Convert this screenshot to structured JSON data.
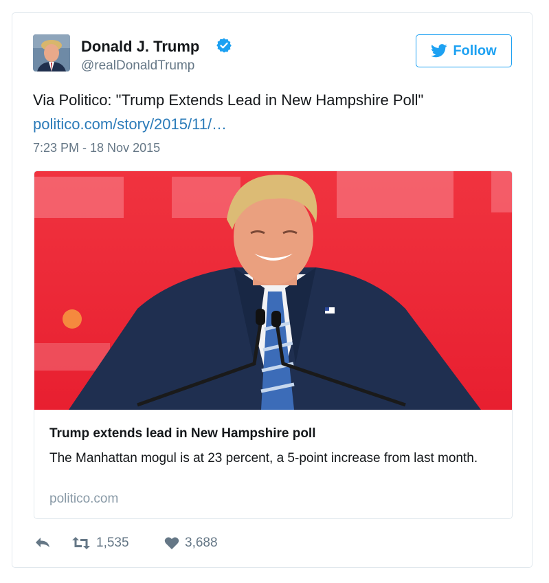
{
  "user": {
    "name": "Donald J. Trump",
    "handle": "@realDonaldTrump",
    "verified": true
  },
  "follow_button": {
    "label": "Follow",
    "icon": "twitter-bird-icon"
  },
  "tweet": {
    "text": "Via Politico: \"Trump Extends Lead in New Hampshire Poll\"",
    "link": "politico.com/story/2015/11/…",
    "timestamp": "7:23 PM - 18 Nov 2015"
  },
  "card": {
    "title": "Trump extends lead in New Hampshire poll",
    "description": "The Manhattan mogul is at 23 percent, a 5-point increase from last month.",
    "domain": "politico.com"
  },
  "actions": {
    "reply_icon": "reply-icon",
    "retweet_icon": "retweet-icon",
    "retweets": "1,535",
    "like_icon": "heart-icon",
    "likes": "3,688"
  },
  "colors": {
    "accent": "#1da1f2",
    "link": "#2b7bb9",
    "muted": "#657786",
    "border": "#e1e8ed",
    "photo_background": "#ee2638"
  }
}
